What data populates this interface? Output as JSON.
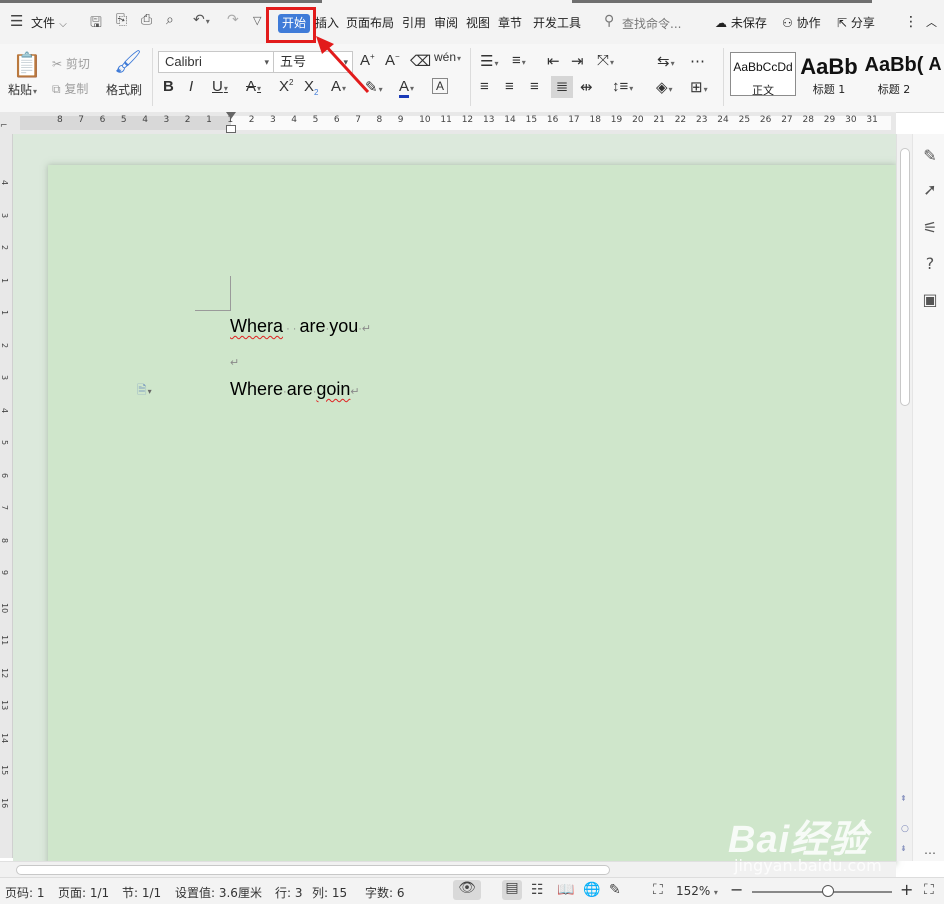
{
  "menu": {
    "file_label": "文件",
    "tabs": [
      "开始",
      "插入",
      "页面布局",
      "引用",
      "审阅",
      "视图",
      "章节",
      "开发工具"
    ],
    "active_tab": "开始",
    "search_placeholder": "查找命令...",
    "unsaved": "未保存",
    "collab": "协作",
    "share": "分享"
  },
  "ribbon": {
    "paste": "粘贴",
    "cut": "剪切",
    "copy": "复制",
    "format_painter": "格式刷",
    "font_name": "Calibri",
    "font_size": "五号",
    "styles": [
      {
        "sample": "AaBbCcDd",
        "label": "正文"
      },
      {
        "sample": "AaBb",
        "label": "标题 1"
      },
      {
        "sample": "AaBb(",
        "label": "标题 2"
      },
      {
        "sample": "A",
        "label": ""
      }
    ]
  },
  "document": {
    "line1_a": "Whera",
    "line1_b": "are",
    "line1_c": "you",
    "line3_a": "Where",
    "line3_b": "are",
    "line3_c": "goin",
    "para_mark": "↵"
  },
  "ruler": {
    "h_numbers": [
      "8",
      "7",
      "6",
      "5",
      "4",
      "3",
      "2",
      "1",
      "1",
      "2",
      "3",
      "4",
      "5",
      "6",
      "7",
      "8",
      "9",
      "10",
      "11",
      "12",
      "13",
      "14",
      "15",
      "16",
      "17",
      "18",
      "19",
      "20",
      "21",
      "22",
      "23",
      "24",
      "25",
      "26",
      "27",
      "28",
      "29",
      "30",
      "31"
    ],
    "v_numbers": [
      "4",
      "3",
      "2",
      "1",
      "1",
      "2",
      "3",
      "4",
      "5",
      "6",
      "7",
      "8",
      "9",
      "10",
      "11",
      "12",
      "13",
      "14",
      "15",
      "16"
    ]
  },
  "status": {
    "page_num": "页码: 1",
    "pages": "页面: 1/1",
    "section": "节: 1/1",
    "setting": "设置值: 3.6厘米",
    "row": "行: 3",
    "col": "列: 15",
    "word_count": "字数: 6",
    "zoom": "152%"
  },
  "watermark": {
    "brand": "Bai经验",
    "url": "jingyan.baidu.com"
  },
  "colors": {
    "accent": "#3f7bd8",
    "highlight_box": "#e21b1b",
    "page_bg": "#cfe6cb"
  }
}
